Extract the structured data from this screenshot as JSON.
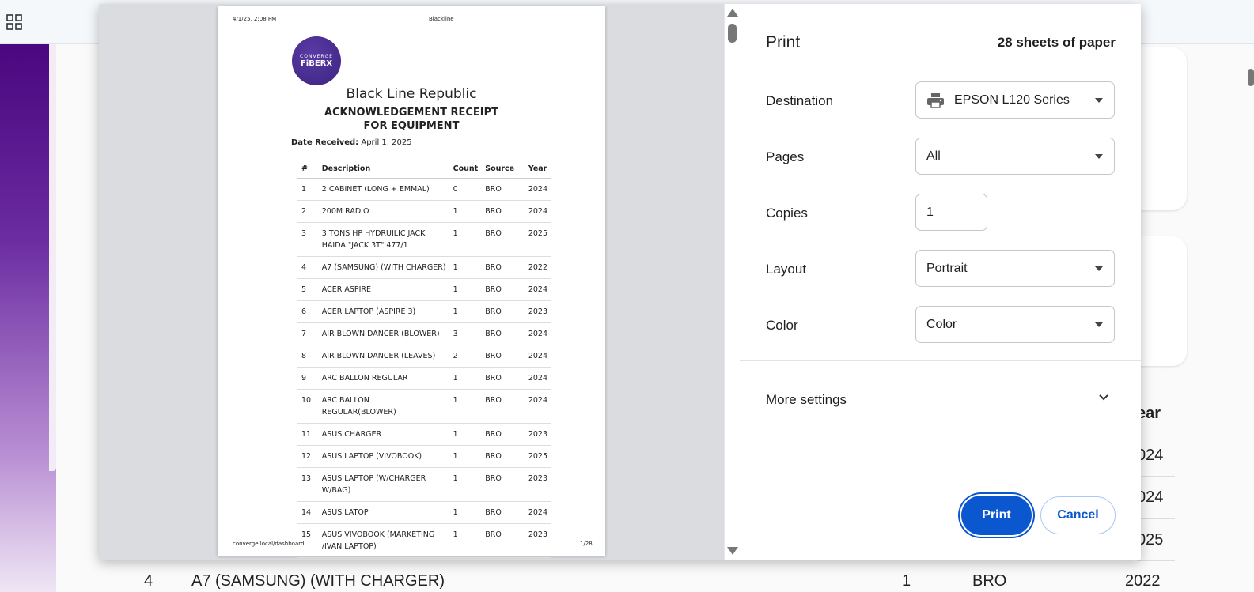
{
  "background": {
    "year_header": "ear",
    "years": [
      "024",
      "024",
      "025"
    ],
    "bottom_row": {
      "num": "4",
      "desc": "A7 (SAMSUNG) (WITH CHARGER)",
      "count": "1",
      "source": "BRO",
      "year": "2022"
    }
  },
  "preview": {
    "header_date": "4/1/25, 2:08 PM",
    "header_title": "Blackline",
    "logo_top": "CONVERGE",
    "logo_bottom": "FiBERX",
    "company": "Black Line Republic",
    "heading": "ACKNOWLEDGEMENT RECEIPT FOR EQUIPMENT",
    "date_label": "Date Received:",
    "date_value": "April 1, 2025",
    "columns": [
      "#",
      "Description",
      "Count",
      "Source",
      "Year"
    ],
    "rows": [
      [
        "1",
        "2 CABINET (LONG + EMMAL)",
        "0",
        "BRO",
        "2024"
      ],
      [
        "2",
        "200M RADIO",
        "1",
        "BRO",
        "2024"
      ],
      [
        "3",
        "3 TONS HP HYDRUILIC JACK HAIDA \"JACK 3T\" 477/1",
        "1",
        "BRO",
        "2025"
      ],
      [
        "4",
        "A7 (SAMSUNG) (WITH CHARGER)",
        "1",
        "BRO",
        "2022"
      ],
      [
        "5",
        "ACER ASPIRE",
        "1",
        "BRO",
        "2024"
      ],
      [
        "6",
        "ACER LAPTOP (ASPIRE 3)",
        "1",
        "BRO",
        "2023"
      ],
      [
        "7",
        "AIR BLOWN DANCER (BLOWER)",
        "3",
        "BRO",
        "2024"
      ],
      [
        "8",
        "AIR BLOWN DANCER (LEAVES)",
        "2",
        "BRO",
        "2024"
      ],
      [
        "9",
        "ARC BALLON REGULAR",
        "1",
        "BRO",
        "2024"
      ],
      [
        "10",
        "ARC BALLON REGULAR(BLOWER)",
        "1",
        "BRO",
        "2024"
      ],
      [
        "11",
        "ASUS CHARGER",
        "1",
        "BRO",
        "2023"
      ],
      [
        "12",
        "ASUS LAPTOP (VIVOBOOK)",
        "1",
        "BRO",
        "2025"
      ],
      [
        "13",
        "ASUS LAPTOP (W/CHARGER W/BAG)",
        "1",
        "BRO",
        "2023"
      ],
      [
        "14",
        "ASUS LATOP",
        "1",
        "BRO",
        "2024"
      ],
      [
        "15",
        "ASUS VIVOBOOK (MARKETING /IVAN LAPTOP)",
        "1",
        "BRO",
        "2023"
      ]
    ],
    "footer_url": "converge.local/dashboard",
    "footer_page": "1/28"
  },
  "print": {
    "title": "Print",
    "sheets": "28 sheets of paper",
    "destination_label": "Destination",
    "destination_value": "EPSON L120 Series",
    "pages_label": "Pages",
    "pages_value": "All",
    "copies_label": "Copies",
    "copies_value": "1",
    "layout_label": "Layout",
    "layout_value": "Portrait",
    "color_label": "Color",
    "color_value": "Color",
    "more_settings": "More settings",
    "print_button": "Print",
    "cancel_button": "Cancel"
  },
  "colors": {
    "accent": "#0b57d0",
    "sidebar": "#4a077f"
  },
  "icons": [
    "apps-grid-icon",
    "printer-icon",
    "dropdown-arrow-icon",
    "chevron-down-icon",
    "scroll-up-icon",
    "scroll-down-icon"
  ]
}
